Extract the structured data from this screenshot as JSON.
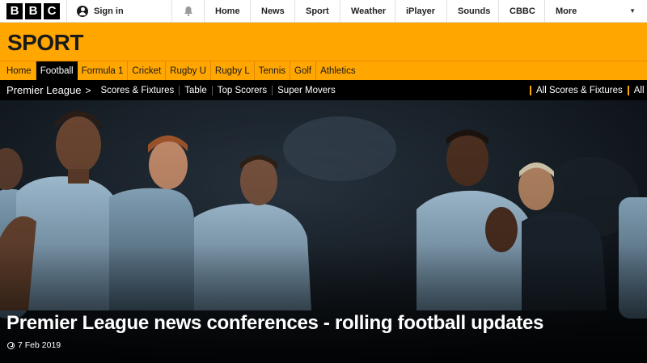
{
  "global_nav": {
    "logo": [
      "B",
      "B",
      "C"
    ],
    "signin_label": "Sign in",
    "items": [
      "Home",
      "News",
      "Sport",
      "Weather",
      "iPlayer",
      "Sounds",
      "CBBC"
    ],
    "more_label": "More"
  },
  "sport_header": {
    "title": "SPORT"
  },
  "section_nav": {
    "items": [
      "Home",
      "Football",
      "Formula 1",
      "Cricket",
      "Rugby U",
      "Rugby L",
      "Tennis",
      "Golf",
      "Athletics"
    ],
    "active": "Football"
  },
  "sub_nav": {
    "section": "Premier League",
    "items": [
      "Scores & Fixtures",
      "Table",
      "Top Scorers",
      "Super Movers"
    ],
    "right_items": [
      "All Scores & Fixtures",
      "All T"
    ]
  },
  "hero": {
    "headline": "Premier League news conferences - rolling football updates",
    "date": "7 Feb 2019"
  },
  "colors": {
    "sport_orange": "#ffa600",
    "nav_black": "#000000"
  }
}
